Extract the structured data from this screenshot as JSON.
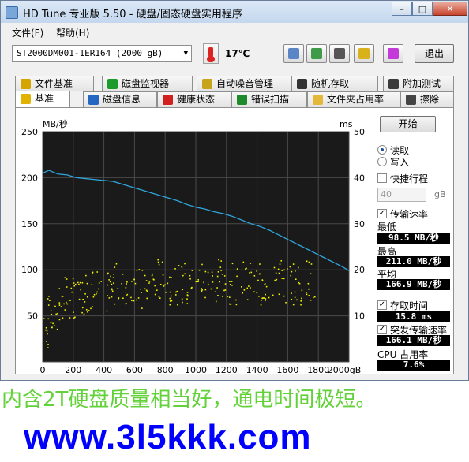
{
  "window": {
    "title": "HD Tune 专业版 5.50 - 硬盘/固态硬盘实用程序",
    "controls": [
      "minimize",
      "maximize",
      "close"
    ]
  },
  "menu": [
    {
      "label": "文件(F)"
    },
    {
      "label": "帮助(H)"
    }
  ],
  "toolbar": {
    "drive": "ST2000DM001-1ER164 (2000 gB)",
    "temperature": "17℃",
    "buttons": [
      {
        "icon": "copy-text-icon",
        "color": "#5b86c5"
      },
      {
        "icon": "copy-screenshot-icon",
        "color": "#3f9a4a"
      },
      {
        "icon": "camera-icon",
        "color": "#555555"
      },
      {
        "icon": "options-icon",
        "color": "#d9b11a"
      },
      {
        "icon": "save-download-icon",
        "color": "#c43ad8"
      }
    ],
    "exit_label": "退出"
  },
  "tabs_top": [
    {
      "label": "文件基准",
      "icon": "file-benchmark-icon",
      "color": "#d4a400"
    },
    {
      "label": "磁盘监视器",
      "icon": "disk-monitor-icon",
      "color": "#1c9a2b"
    },
    {
      "label": "自动噪音管理",
      "icon": "speaker-icon",
      "color": "#c8a31c"
    },
    {
      "label": "随机存取",
      "icon": "random-access-icon",
      "color": "#333333"
    },
    {
      "label": "附加测试",
      "icon": "extra-tests-icon",
      "color": "#3a3a3a"
    }
  ],
  "tabs_bottom": [
    {
      "label": "基准",
      "icon": "benchmark-icon",
      "color": "#e1b200",
      "active": true
    },
    {
      "label": "磁盘信息",
      "icon": "info-icon",
      "color": "#2467c3"
    },
    {
      "label": "健康状态",
      "icon": "health-cross-icon",
      "color": "#d21f1f"
    },
    {
      "label": "错误扫描",
      "icon": "error-scan-icon",
      "color": "#1f8a2c"
    },
    {
      "label": "文件夹占用率",
      "icon": "folder-icon",
      "color": "#e6b83a"
    },
    {
      "label": "擦除",
      "icon": "trash-icon",
      "color": "#444444"
    }
  ],
  "benchmark": {
    "start_label": "开始",
    "mode_read": "读取",
    "mode_write": "写入",
    "short_stroke_label": "快捷行程",
    "short_stroke_value": "40",
    "short_stroke_unit": "gB",
    "transfer_rate_label": "传输速率",
    "min_label": "最低",
    "min_value": "98.5 MB/秒",
    "max_label": "最高",
    "max_value": "211.0 MB/秒",
    "avg_label": "平均",
    "avg_value": "166.9 MB/秒",
    "access_time_label": "存取时间",
    "access_time_value": "15.8 ms",
    "burst_rate_label": "突发传输速率",
    "burst_rate_value": "166.1 MB/秒",
    "cpu_label": "CPU 占用率",
    "cpu_value": "7.6%"
  },
  "chart_data": {
    "type": "line",
    "left_unit": "MB/秒",
    "right_unit": "ms",
    "x_ticks": [
      "0",
      "200",
      "400",
      "600",
      "800",
      "1000",
      "1200",
      "1400",
      "1600",
      "1800",
      "2000gB"
    ],
    "y_left_ticks": [
      "250",
      "200",
      "150",
      "100",
      "50"
    ],
    "y_right_ticks": [
      "50",
      "40",
      "30",
      "20",
      "10"
    ],
    "xlim": [
      0,
      2000
    ],
    "ylim_left": [
      0,
      250
    ],
    "ylim_right": [
      0,
      50
    ],
    "grid": true,
    "series": [
      {
        "color": "#2fa6dc",
        "x": [
          0,
          40,
          100,
          160,
          220,
          280,
          340,
          400,
          460,
          520,
          580,
          640,
          700,
          760,
          820,
          880,
          940,
          1000,
          1060,
          1120,
          1180,
          1240,
          1300,
          1360,
          1420,
          1480,
          1540,
          1600,
          1660,
          1720,
          1780,
          1840,
          1900,
          1960,
          2000
        ],
        "values": [
          205,
          208,
          204,
          203,
          200,
          199,
          198,
          197,
          196,
          193,
          190,
          187,
          184,
          181,
          178,
          175,
          171,
          168,
          166,
          163,
          161,
          158,
          154,
          150,
          147,
          143,
          138,
          133,
          128,
          123,
          118,
          113,
          108,
          103,
          99
        ]
      },
      {
        "color": "#f0f000",
        "type": "scatter",
        "x": [
          20,
          60,
          110,
          170,
          230,
          290,
          350,
          420,
          480,
          550,
          620,
          690,
          760,
          830,
          900,
          970,
          1040,
          1110,
          1180,
          1250,
          1320,
          1390,
          1460,
          1530,
          1600,
          1670,
          1740
        ],
        "values": [
          7,
          10,
          13,
          14,
          14,
          15,
          16,
          15,
          17,
          17,
          16,
          17,
          18,
          17,
          17,
          16,
          18,
          17,
          18,
          17,
          18,
          17,
          17,
          18,
          17,
          17,
          18
        ]
      }
    ]
  },
  "caption": "内含2T硬盘质量相当好，通电时间极短。",
  "website": "www.3l5kkk.com"
}
